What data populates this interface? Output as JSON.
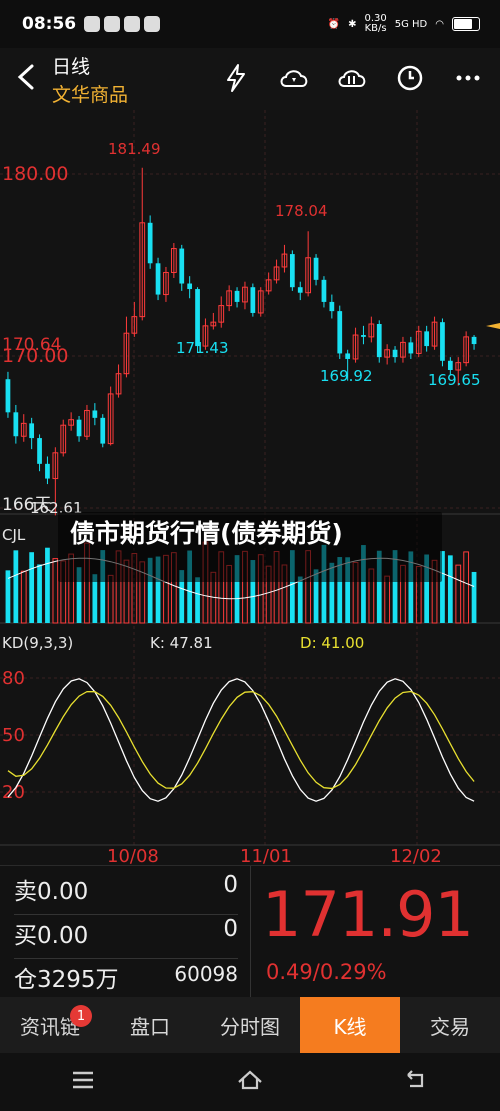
{
  "status_bar": {
    "time": "08:56",
    "net_speed": "0.30",
    "net_unit": "KB/s",
    "signal": "5G HD"
  },
  "header": {
    "period": "日线",
    "product_name": "文华商品",
    "icons": [
      "lightning-icon",
      "cloud-sync-icon",
      "cloud-indicator-icon",
      "clock-icon",
      "more-icon"
    ]
  },
  "overlay": {
    "title": "债市期货行情(债券期货)"
  },
  "chart_data": [
    {
      "type": "candlestick",
      "y_ticks": [
        "180.00",
        "170.64",
        "170.00",
        "166天"
      ],
      "annotations": [
        "181.49",
        "178.04",
        "171.43",
        "169.92",
        "169.65",
        "162.61"
      ],
      "y_range": [
        163,
        183
      ],
      "x_labels": [
        "10/08",
        "11/01",
        "12/02"
      ],
      "colors": {
        "up": "#ff3b3b",
        "down": "#19e0f2",
        "last": "#f2b233"
      },
      "candles": [
        [
          170.0,
          168.2,
          170.4,
          167.9
        ],
        [
          168.2,
          166.9,
          168.6,
          166.5
        ],
        [
          166.9,
          167.6,
          168.1,
          166.6
        ],
        [
          167.6,
          166.8,
          167.9,
          166.2
        ],
        [
          166.8,
          165.4,
          167.0,
          165.0
        ],
        [
          165.4,
          164.6,
          165.8,
          164.3
        ],
        [
          164.6,
          166.0,
          166.3,
          162.6
        ],
        [
          166.0,
          167.5,
          167.8,
          165.8
        ],
        [
          167.5,
          167.8,
          168.2,
          167.2
        ],
        [
          167.8,
          166.9,
          168.0,
          166.6
        ],
        [
          166.9,
          168.3,
          168.6,
          166.7
        ],
        [
          168.3,
          167.9,
          168.7,
          167.5
        ],
        [
          167.9,
          166.5,
          168.1,
          166.3
        ],
        [
          166.5,
          169.2,
          169.6,
          166.4
        ],
        [
          169.2,
          170.3,
          170.8,
          169.0
        ],
        [
          170.3,
          172.5,
          173.4,
          170.1
        ],
        [
          172.5,
          173.4,
          174.2,
          172.3
        ],
        [
          173.4,
          178.5,
          181.49,
          173.2
        ],
        [
          178.5,
          176.3,
          178.9,
          176.0
        ],
        [
          176.3,
          174.6,
          176.6,
          174.3
        ],
        [
          174.6,
          175.8,
          176.1,
          174.2
        ],
        [
          175.8,
          177.1,
          177.4,
          175.5
        ],
        [
          177.1,
          175.2,
          177.3,
          174.8
        ],
        [
          175.2,
          174.9,
          175.6,
          174.4
        ],
        [
          174.9,
          171.8,
          175.0,
          171.43
        ],
        [
          171.8,
          172.9,
          173.3,
          171.6
        ],
        [
          172.9,
          173.1,
          173.6,
          172.7
        ],
        [
          173.1,
          174.0,
          174.5,
          172.8
        ],
        [
          174.0,
          174.8,
          175.1,
          173.7
        ],
        [
          174.8,
          174.2,
          175.0,
          173.9
        ],
        [
          174.2,
          175.0,
          175.3,
          173.8
        ],
        [
          175.0,
          173.6,
          175.2,
          173.4
        ],
        [
          173.6,
          174.8,
          175.0,
          173.4
        ],
        [
          174.8,
          175.4,
          175.8,
          174.6
        ],
        [
          175.4,
          176.1,
          176.5,
          175.2
        ],
        [
          176.1,
          176.8,
          177.3,
          175.8
        ],
        [
          176.8,
          175.0,
          177.0,
          174.8
        ],
        [
          175.0,
          174.7,
          175.3,
          174.3
        ],
        [
          174.7,
          176.6,
          178.04,
          174.5
        ],
        [
          176.6,
          175.4,
          176.8,
          175.1
        ],
        [
          175.4,
          174.2,
          175.6,
          173.9
        ],
        [
          174.2,
          173.7,
          174.6,
          173.3
        ],
        [
          173.7,
          171.4,
          174.0,
          171.1
        ],
        [
          171.4,
          171.1,
          171.6,
          169.92
        ],
        [
          171.1,
          172.4,
          172.8,
          170.9
        ],
        [
          172.4,
          172.3,
          172.9,
          171.9
        ],
        [
          172.3,
          173.0,
          173.4,
          172.0
        ],
        [
          173.0,
          171.2,
          173.2,
          170.9
        ],
        [
          171.2,
          171.6,
          171.9,
          170.8
        ],
        [
          171.6,
          171.2,
          171.8,
          170.9
        ],
        [
          171.2,
          172.0,
          172.3,
          170.9
        ],
        [
          172.0,
          171.4,
          172.3,
          171.1
        ],
        [
          171.4,
          172.6,
          172.9,
          171.2
        ],
        [
          172.6,
          171.8,
          172.9,
          171.5
        ],
        [
          171.8,
          173.1,
          173.4,
          171.6
        ],
        [
          173.1,
          171.0,
          173.3,
          170.7
        ],
        [
          171.0,
          170.5,
          171.2,
          170.2
        ],
        [
          170.5,
          170.9,
          171.2,
          169.65
        ],
        [
          170.9,
          172.3,
          172.6,
          170.7
        ],
        [
          172.3,
          171.91,
          172.4,
          171.6
        ]
      ]
    },
    {
      "type": "bar",
      "title": "CJL",
      "colors": {
        "up": "#ff3b3b",
        "down": "#19e0f2",
        "line": "#ffffff"
      }
    },
    {
      "type": "line",
      "title": "KD(9,3,3)",
      "series": [
        {
          "name": "K",
          "last": "47.81"
        },
        {
          "name": "D",
          "last": "41.00"
        }
      ],
      "y_ticks": [
        "80",
        "50",
        "20"
      ],
      "colors": {
        "K": "#ffffff",
        "D": "#e8e030"
      }
    }
  ],
  "quote": {
    "sell_label": "卖",
    "sell_price": "0.00",
    "sell_qty": "0",
    "buy_label": "买",
    "buy_price": "0.00",
    "buy_qty": "0",
    "oi_label": "仓",
    "oi_value": "3295万",
    "oi_right": "60098",
    "last_price": "171.91",
    "change": "0.49/0.29%"
  },
  "tabs": [
    {
      "label": "资讯链",
      "badge": "1",
      "active": false
    },
    {
      "label": "盘口",
      "active": false
    },
    {
      "label": "分时图",
      "active": false
    },
    {
      "label": "K线",
      "active": true
    },
    {
      "label": "交易",
      "active": false
    }
  ],
  "nav": [
    "menu-icon",
    "home-icon",
    "back-icon"
  ]
}
